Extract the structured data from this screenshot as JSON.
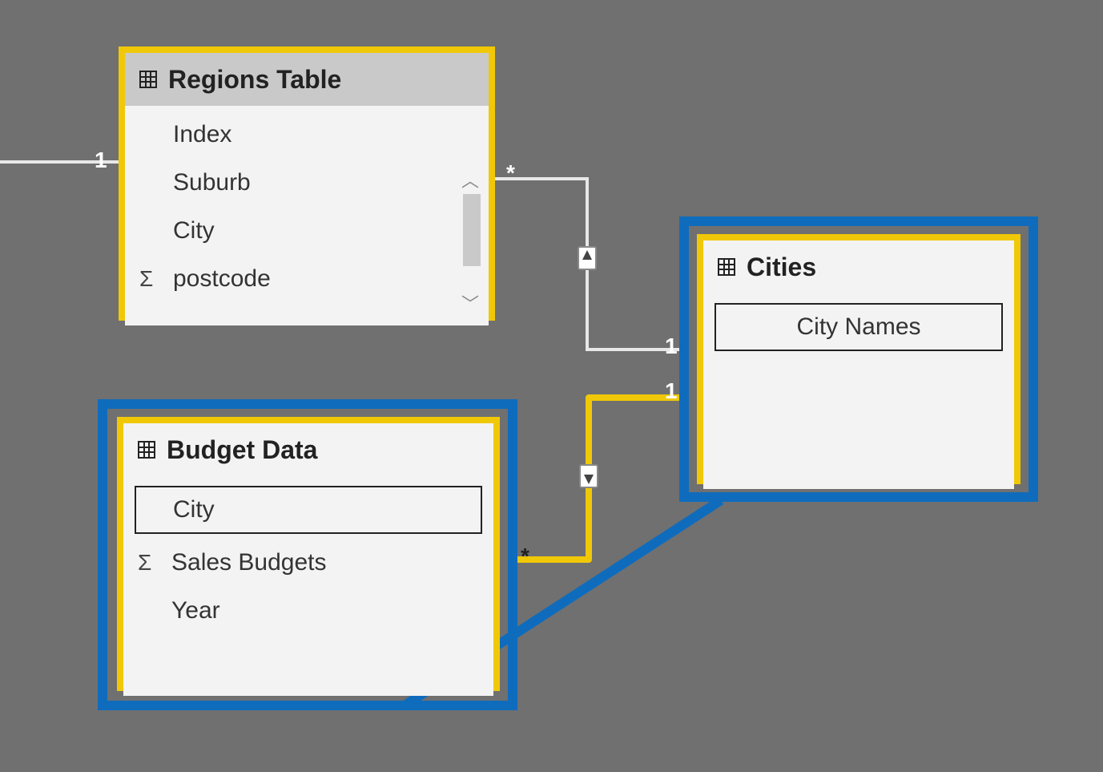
{
  "tables": {
    "regions": {
      "title": "Regions Table",
      "fields": [
        "Index",
        "Suburb",
        "City",
        "postcode"
      ],
      "sigma_field": "postcode",
      "selected": true
    },
    "budget": {
      "title": "Budget Data",
      "fields": [
        "City",
        "Sales Budgets",
        "Year"
      ],
      "sigma_field": "Sales Budgets",
      "boxed_field": "City"
    },
    "cities": {
      "title": "Cities",
      "fields": [
        "City Names"
      ],
      "boxed_field": "City Names"
    }
  },
  "relationships": [
    {
      "from": "external",
      "to": "regions",
      "from_card": "1"
    },
    {
      "from": "regions",
      "to": "cities",
      "from_card": "*",
      "to_card": "1",
      "direction": "to_regions"
    },
    {
      "from": "cities",
      "to": "budget",
      "from_card": "1",
      "to_card": "*",
      "direction": "to_budget",
      "highlighted": true
    }
  ],
  "cardinality": {
    "one": "1",
    "many": "*"
  }
}
